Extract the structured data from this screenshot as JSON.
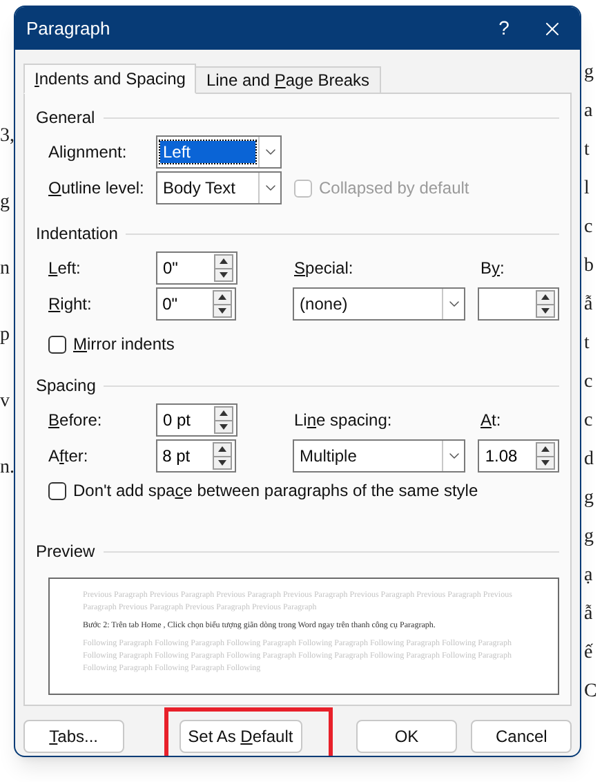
{
  "background_document": {
    "left_fragments": [
      "3,",
      "g",
      "n",
      "p",
      "v",
      "n."
    ],
    "right_fragments": [
      "g",
      "a",
      "t",
      "l",
      "c",
      "b",
      "ẫ",
      "t",
      "c",
      "c",
      "d",
      "g",
      "g",
      "ạ",
      "ẫ",
      "ế",
      "C"
    ]
  },
  "window": {
    "title": "Paragraph",
    "help": "?"
  },
  "tabs": [
    {
      "label": {
        "key": "I",
        "post": "ndents and Spacing"
      },
      "selected": true
    },
    {
      "label": {
        "pre": "Line and ",
        "key": "P",
        "post": "age Breaks"
      },
      "selected": false
    }
  ],
  "general": {
    "title": "General",
    "alignment": {
      "label": {
        "pre": "Ali",
        "key": "g",
        "post": "nment:"
      },
      "value": "Left",
      "highlighted": true
    },
    "outline_level": {
      "label": {
        "key": "O",
        "post": "utline level:"
      },
      "value": "Body Text"
    },
    "collapsed": {
      "label": "Collapsed by default",
      "checked": false,
      "disabled": true
    }
  },
  "indentation": {
    "title": "Indentation",
    "left": {
      "label": {
        "key": "L",
        "post": "eft:"
      },
      "value": "0\""
    },
    "right": {
      "label": {
        "key": "R",
        "post": "ight:"
      },
      "value": "0\""
    },
    "special": {
      "label": {
        "key": "S",
        "post": "pecial:"
      },
      "value": "(none)"
    },
    "by": {
      "label": {
        "pre": "B",
        "key": "y",
        "post": ":"
      }
    },
    "mirror": {
      "label": {
        "key": "M",
        "post": "irror indents"
      },
      "checked": false
    }
  },
  "spacing": {
    "title": "Spacing",
    "before": {
      "label": {
        "key": "B",
        "post": "efore:"
      },
      "value": "0 pt"
    },
    "after": {
      "label": {
        "pre": "A",
        "key": "f",
        "post": "ter:"
      },
      "value": "8 pt"
    },
    "line_spacing": {
      "label": {
        "pre": "Li",
        "key": "n",
        "post": "e spacing:"
      },
      "value": "Multiple"
    },
    "at": {
      "label": {
        "key": "A",
        "post": "t:"
      },
      "value": "1.08"
    },
    "dont_add": {
      "label": {
        "pre": "Don't add spa",
        "key": "c",
        "post": "e between paragraphs of the same style"
      },
      "checked": false
    }
  },
  "preview": {
    "title": "Preview",
    "previous": "Previous Paragraph Previous Paragraph Previous Paragraph Previous Paragraph Previous Paragraph Previous Paragraph Previous Paragraph Previous Paragraph Previous Paragraph Previous Paragraph",
    "current": "Bước 2: Trên tab Home , Click chọn biểu tượng giãn dòng trong Word ngay trên thanh công cụ Paragraph.",
    "following": "Following Paragraph Following Paragraph Following Paragraph Following Paragraph Following Paragraph Following Paragraph Following Paragraph Following Paragraph Following Paragraph Following Paragraph Following Paragraph Following Paragraph Following Paragraph Following Paragraph Following"
  },
  "buttons": [
    {
      "kind": "tabs",
      "label": {
        "key": "T",
        "post": "abs..."
      },
      "highlighted": false
    },
    {
      "kind": "default",
      "label": {
        "pre": "Set As ",
        "key": "D",
        "post": "efault"
      },
      "highlighted": true
    },
    {
      "kind": "ok",
      "label": {
        "post": "OK"
      },
      "highlighted": false
    },
    {
      "kind": "cancel",
      "label": {
        "post": "Cancel"
      },
      "highlighted": false
    }
  ]
}
